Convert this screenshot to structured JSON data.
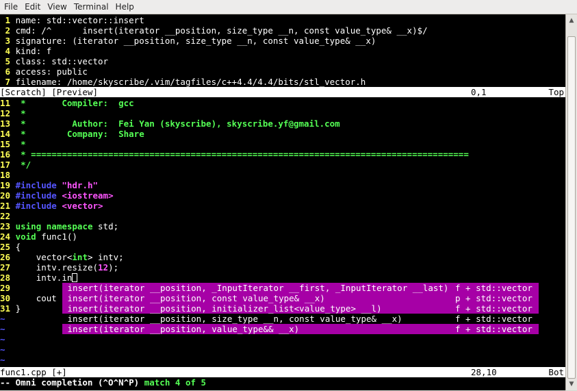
{
  "menu": [
    "File",
    "Edit",
    "View",
    "Terminal",
    "Help"
  ],
  "preview": {
    "lines": [
      {
        "n": " 1",
        "text": "name: std::vector::insert"
      },
      {
        "n": " 2",
        "text": "cmd: /^\tinsert(iterator __position, size_type __n, const value_type& __x)$/"
      },
      {
        "n": " 3",
        "text": "signature: (iterator __position, size_type __n, const value_type& __x)"
      },
      {
        "n": " 4",
        "text": "kind: f"
      },
      {
        "n": " 5",
        "text": "class: std::vector"
      },
      {
        "n": " 6",
        "text": "access: public"
      },
      {
        "n": " 7",
        "text": "filename: /home/skyscribe/.vim/tagfiles/c++4.4/4.4/bits/stl_vector.h"
      }
    ],
    "status": {
      "name": "[Scratch] [Preview]",
      "pos": "0,1",
      "scroll": "Top"
    }
  },
  "code": {
    "l11": {
      "n": "11",
      "text": " *       Compiler:  gcc"
    },
    "l12": {
      "n": "12",
      "text": " *"
    },
    "l13": {
      "n": "13",
      "text": " *         Author:  Fei Yan (skyscribe), skyscribe.yf@gmail.com"
    },
    "l14": {
      "n": "14",
      "text": " *        Company:  Share"
    },
    "l15": {
      "n": "15",
      "text": " *"
    },
    "l16": {
      "n": "16",
      "text": " * ====================================================================================="
    },
    "l17": {
      "n": "17",
      "text": " */"
    },
    "l18": {
      "n": "18",
      "text": ""
    },
    "l19": {
      "n": "19",
      "kw": "#include",
      "rest": "\"hdr.h\""
    },
    "l20": {
      "n": "20",
      "kw": "#include",
      "rest": "<iostream>"
    },
    "l21": {
      "n": "21",
      "kw": "#include",
      "rest": "<vector>"
    },
    "l22": {
      "n": "22",
      "text": ""
    },
    "l23": {
      "n": "23",
      "kw1": "using",
      "kw2": "namespace",
      "rest": " std;"
    },
    "l24": {
      "n": "24",
      "kw": "void",
      "rest": " func1()"
    },
    "l25": {
      "n": "25",
      "text": "{"
    },
    "l26": {
      "n": "26",
      "pre": "    vector<",
      "kw": "int",
      "rest": "> intv;"
    },
    "l27": {
      "n": "27",
      "pre": "    intv.resize(",
      "num": "12",
      "rest": ");"
    },
    "l28": {
      "n": "28",
      "text": "    intv.in"
    },
    "l29": {
      "n": "29"
    },
    "l30": {
      "n": "30",
      "text": "    cout"
    },
    "l31": {
      "n": "31",
      "text": "}"
    }
  },
  "tilde": "~",
  "popup": [
    {
      "sig": "insert(iterator __position, _InputIterator __first, _InputIterator __last)",
      "kind": "f + std::vector"
    },
    {
      "sig": "insert(iterator __position, const value_type& __x)",
      "kind": "p + std::vector"
    },
    {
      "sig": "insert(iterator __position, initializer_list<value_type> __l)",
      "kind": "f + std::vector"
    },
    {
      "sig": "insert(iterator __position, size_type __n, const value_type& __x)",
      "kind": "f + std::vector"
    },
    {
      "sig": "insert(iterator __position, value_type&& __x)",
      "kind": "f + std::vector"
    }
  ],
  "file_status": {
    "name": "func1.cpp [+]",
    "pos": "28,10",
    "scroll": "Bot"
  },
  "message": {
    "mode": "-- Omni completion (^O^N^P)",
    "match": "match 4 of 5"
  }
}
